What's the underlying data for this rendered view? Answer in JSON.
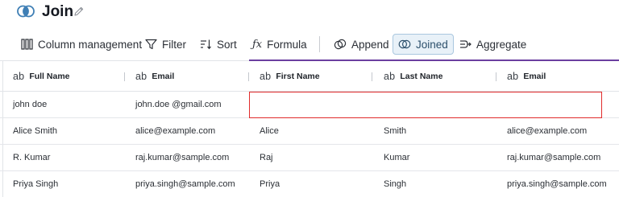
{
  "header": {
    "title": "Join",
    "logo_icon": "venn-circles-icon",
    "edit_icon": "pencil-icon"
  },
  "toolbar": {
    "items": [
      {
        "label": "Column management",
        "icon": "columns-icon"
      },
      {
        "label": "Filter",
        "icon": "filter-icon"
      },
      {
        "label": "Sort",
        "icon": "sort-icon"
      },
      {
        "label": "Formula",
        "icon": "formula-icon"
      },
      {
        "label": "Append",
        "icon": "append-icon"
      },
      {
        "label": "Joined",
        "icon": "joined-icon",
        "active": true
      },
      {
        "label": "Aggregate",
        "icon": "aggregate-icon"
      }
    ]
  },
  "table": {
    "type_badge": "ab",
    "columns": [
      "Full Name",
      "Email",
      "First Name",
      "Last Name",
      "Email"
    ],
    "rows": [
      [
        "john doe",
        "john.doe @gmail.com",
        "",
        "",
        ""
      ],
      [
        "Alice Smith",
        "alice@example.com",
        "Alice",
        "Smith",
        "alice@example.com"
      ],
      [
        "R. Kumar",
        "raj.kumar@sample.com",
        "Raj",
        "Kumar",
        "raj.kumar@sample.com"
      ],
      [
        "Priya Singh",
        "priya.singh@sample.com",
        "Priya",
        "Singh",
        "priya.singh@sample.com"
      ]
    ]
  },
  "colors": {
    "accent_purple": "#6b3fa0",
    "highlight_red": "#e12b2b",
    "active_bg": "#e8f1f8",
    "logo_blue": "#3f7fb5"
  }
}
